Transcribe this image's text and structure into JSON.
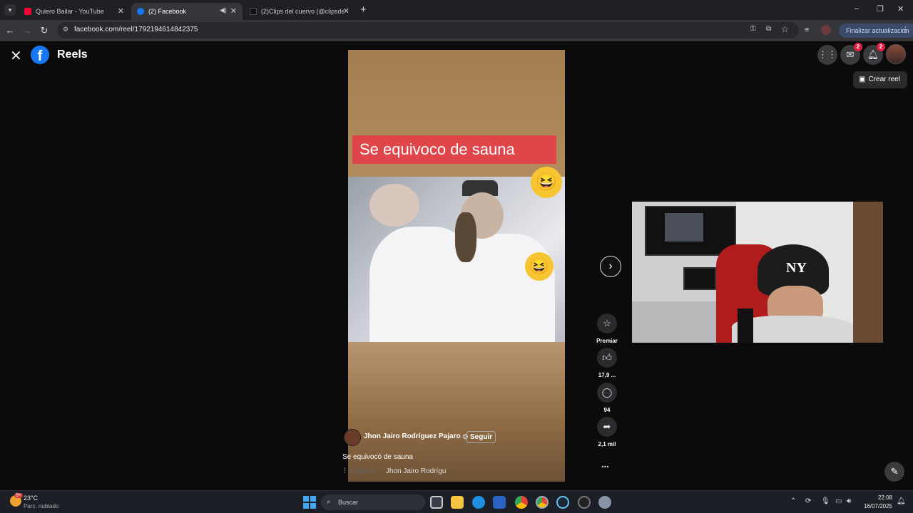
{
  "browser": {
    "tabs": [
      {
        "title": "Quiero Bailar - YouTube",
        "active": false
      },
      {
        "title": "(2) Facebook",
        "active": true
      },
      {
        "title": "(2)Clips del cuervo (@clipsdelc",
        "active": false
      }
    ],
    "new_tab": "+",
    "url": "facebook.com/reel/1792194614842375",
    "update_button": "Finalizar actualización"
  },
  "header": {
    "section_title": "Reels",
    "logo_letter": "f",
    "messenger_badge": "2",
    "notifications_badge": "2",
    "create_reel": "Crear reel"
  },
  "reel": {
    "caption_overlay": "Se equivoco de sauna",
    "author": "Jhon Jairo Rodríguez Pajaro",
    "follow": "Seguir",
    "description": "Se equivocó de sauna",
    "audio_label": "Original",
    "audio_author": "Jhon Jairo Rodrígu"
  },
  "actions": {
    "premiar": "Premiar",
    "likes": "17,9 ...",
    "comments": "94",
    "shares": "2,1 mil",
    "more": "..."
  },
  "taskbar": {
    "weather_temp": "23°C",
    "weather_desc": "Parc. nublado",
    "weather_badge": "9+",
    "search_placeholder": "Buscar",
    "time": "22:08",
    "date": "16/07/2025"
  },
  "colors": {
    "facebook_blue": "#1877f2",
    "caption_red": "#e0454a",
    "badge_red": "#e41e3f"
  }
}
